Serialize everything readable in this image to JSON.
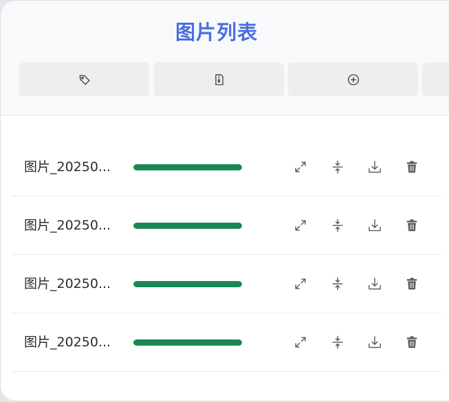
{
  "app": {
    "title": "图片列表"
  },
  "colors": {
    "title": "#4a6ee0",
    "progress_fill": "#198754",
    "icon": "#555555"
  },
  "toolbar": {
    "buttons": [
      {
        "icon": "tag-icon"
      },
      {
        "icon": "file-zip-icon"
      },
      {
        "icon": "plus-circle-icon"
      },
      {
        "icon": "unknown-icon"
      }
    ]
  },
  "files": [
    {
      "name": "图片_20250...",
      "progress": 1.0
    },
    {
      "name": "图片_20250...",
      "progress": 1.0
    },
    {
      "name": "图片_20250...",
      "progress": 1.0
    },
    {
      "name": "图片_20250...",
      "progress": 1.0
    }
  ],
  "row_actions": [
    {
      "icon": "expand-icon"
    },
    {
      "icon": "compress-icon"
    },
    {
      "icon": "download-icon"
    },
    {
      "icon": "trash-icon"
    }
  ]
}
